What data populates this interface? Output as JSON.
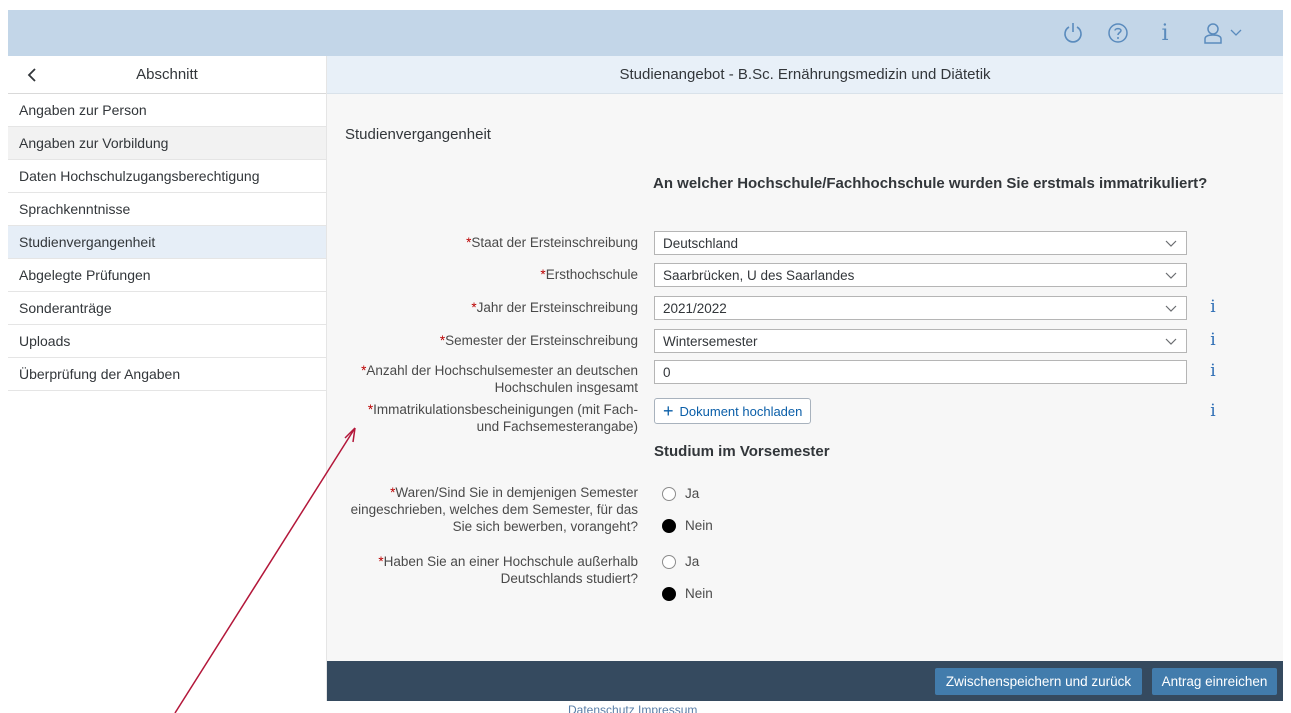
{
  "topbar": {
    "icons": [
      "power-icon",
      "help-icon",
      "info-icon",
      "user-icon",
      "chevron-down-icon"
    ],
    "info_glyph": "i"
  },
  "sidebar": {
    "header": "Abschnitt",
    "items": [
      {
        "label": "Angaben zur Person"
      },
      {
        "label": "Angaben zur Vorbildung"
      },
      {
        "label": "Daten Hochschulzugangsberechtigung"
      },
      {
        "label": "Sprachkenntnisse"
      },
      {
        "label": "Studienvergangenheit"
      },
      {
        "label": "Abgelegte Prüfungen"
      },
      {
        "label": "Sonderanträge"
      },
      {
        "label": "Uploads"
      },
      {
        "label": "Überprüfung der Angaben"
      }
    ]
  },
  "main": {
    "header": "Studienangebot - B.Sc. Ernährungsmedizin und Diätetik",
    "section_title": "Studienvergangenheit",
    "question": "An welcher Hochschule/Fachhochschule wurden Sie erstmals immatrikuliert?",
    "required_mark": "*",
    "fields": {
      "staat": {
        "label": "Staat der Ersteinschreibung",
        "value": "Deutschland"
      },
      "hochschule": {
        "label": "Ersthochschule",
        "value": "Saarbrücken, U des Saarlandes"
      },
      "jahr": {
        "label": "Jahr der Ersteinschreibung",
        "value": "2021/2022"
      },
      "semester": {
        "label": "Semester der Ersteinschreibung",
        "value": "Wintersemester"
      },
      "anzahl": {
        "label": "Anzahl der Hochschulsemester an deutschen Hochschulen insgesamt",
        "value": "0"
      },
      "immatrikulation": {
        "label": "Immatrikulationsbescheinigungen (mit Fach- und Fachsemesterangabe)"
      }
    },
    "upload_button": "Dokument hochladen",
    "subsection": "Studium im Vorsemester",
    "radio_q1": {
      "label": "Waren/Sind Sie in demjenigen Semester eingeschrieben, welches dem Semester, für das Sie sich bewerben, vorangeht?",
      "options": [
        "Ja",
        "Nein"
      ],
      "selected": "Nein"
    },
    "radio_q2": {
      "label": "Haben Sie an einer Hochschule außerhalb Deutschlands studiert?",
      "options": [
        "Ja",
        "Nein"
      ],
      "selected": "Nein"
    }
  },
  "footer": {
    "save_back": "Zwischenspeichern und zurück",
    "submit": "Antrag einreichen",
    "links": "Datenschutz  Impressum"
  }
}
